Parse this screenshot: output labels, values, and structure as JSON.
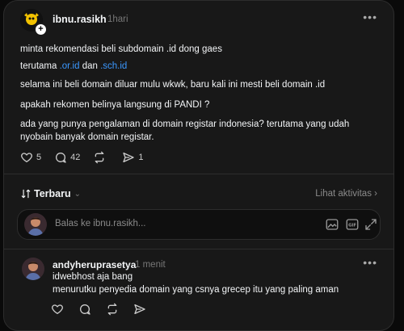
{
  "post": {
    "username": "ibnu.rasikh",
    "time": "1hari",
    "lines": {
      "p1": "minta rekomendasi beli subdomain .id dong gaes",
      "p2_prefix": "terutama ",
      "p2_link1": ".or.id",
      "p2_mid": " dan ",
      "p2_link2": ".sch.id",
      "p3": "selama ini beli domain diluar mulu wkwk, baru kali ini mesti beli domain .id",
      "p4": "apakah rekomen belinya langsung di PANDI ?",
      "p5a": "ada yang punya pengalaman di domain registar indonesia? terutama yang udah",
      "p5b": "nyobain banyak domain registar."
    },
    "likes": "5",
    "comments": "42",
    "shares": "1"
  },
  "sort": {
    "label": "Terbaru",
    "activity_link": "Lihat aktivitas"
  },
  "reply": {
    "placeholder": "Balas ke ibnu.rasikh..."
  },
  "comment": {
    "username": "andyheruprasetya",
    "time": "1 menit",
    "line1": "idwebhost aja bang",
    "line2": "menurutku penyedia domain yang csnya grecep itu yang paling aman"
  },
  "colors": {
    "background": "#181818",
    "text": "#f3f5f7",
    "muted": "#777777",
    "link": "#3b98ff",
    "border": "#2d2d2d"
  }
}
